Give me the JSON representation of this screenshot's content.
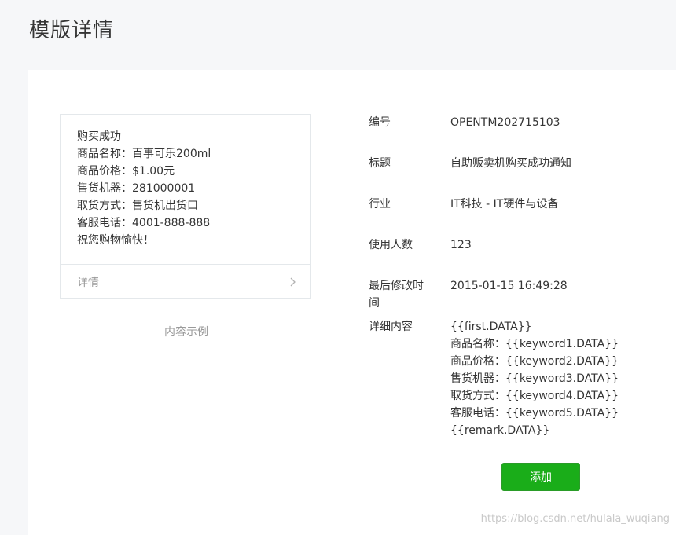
{
  "page": {
    "title": "模版详情"
  },
  "preview": {
    "lines": [
      "购买成功",
      "商品名称：百事可乐200ml",
      "商品价格：$1.00元",
      "售货机器：281000001",
      "取货方式：售货机出货口",
      "客服电话：4001-888-888",
      "祝您购物愉快！"
    ],
    "details_link": "详情",
    "caption": "内容示例"
  },
  "info": {
    "id": {
      "label": "编号",
      "value": "OPENTM202715103"
    },
    "title": {
      "label": "标题",
      "value": "自助贩卖机购买成功通知"
    },
    "industry": {
      "label": "行业",
      "value": "IT科技 - IT硬件与设备"
    },
    "users": {
      "label": "使用人数",
      "value": "123"
    },
    "modified": {
      "label_line1": "最后修改时",
      "label_line2": "间",
      "value": "2015-01-15 16:49:28"
    },
    "detail": {
      "label": "详细内容",
      "lines": [
        "{{first.DATA}}",
        "商品名称：{{keyword1.DATA}}",
        "商品价格：{{keyword2.DATA}}",
        "售货机器：{{keyword3.DATA}}",
        "取货方式：{{keyword4.DATA}}",
        "客服电话：{{keyword5.DATA}}",
        "{{remark.DATA}}"
      ]
    }
  },
  "actions": {
    "add_label": "添加"
  },
  "watermark": "https://blog.csdn.net/hulala_wuqiang",
  "colors": {
    "primary": "#1aad19",
    "background": "#f6f7f9",
    "card": "#ffffff",
    "muted": "#9a9a9a"
  }
}
